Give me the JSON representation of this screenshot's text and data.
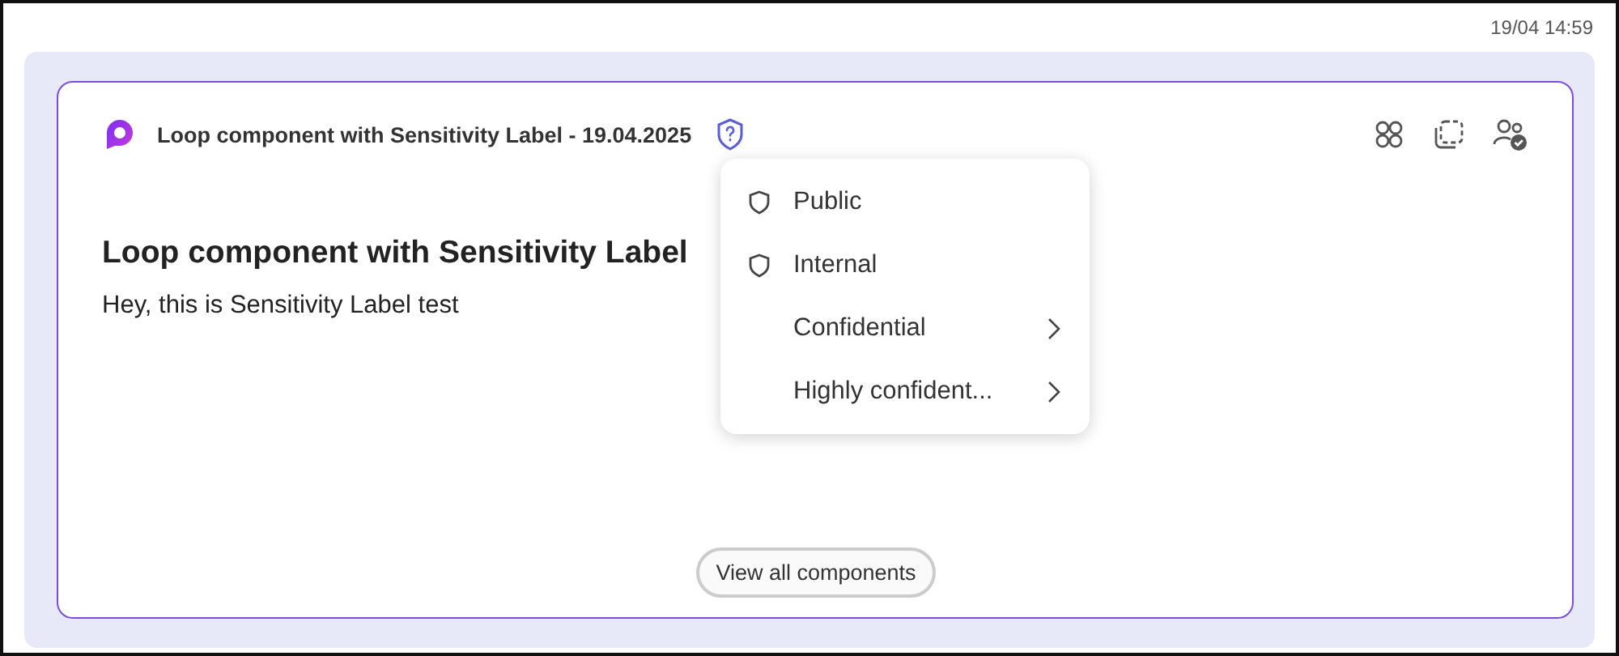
{
  "timestamp": "19/04 14:59",
  "component": {
    "title": "Loop component with Sensitivity Label - 19.04.2025",
    "heading": "Loop component with Sensitivity Label",
    "body": "Hey, this is Sensitivity Label test",
    "button": "View all components"
  },
  "sensitivity_menu": [
    {
      "label": "Public",
      "kind": "shield"
    },
    {
      "label": "Internal",
      "kind": "shield"
    },
    {
      "label": "Confidential",
      "kind": "submenu"
    },
    {
      "label": "Highly confident...",
      "kind": "submenu"
    }
  ]
}
